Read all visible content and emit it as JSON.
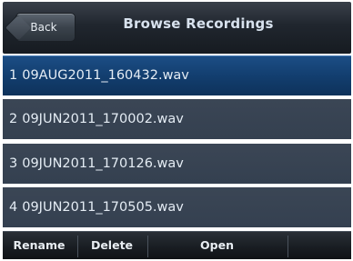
{
  "header": {
    "back_label": "Back",
    "title": "Browse Recordings"
  },
  "recordings": [
    {
      "index": "1",
      "filename": "09AUG2011_160432.wav",
      "selected": true
    },
    {
      "index": "2",
      "filename": "09JUN2011_170002.wav",
      "selected": false
    },
    {
      "index": "3",
      "filename": "09JUN2011_170126.wav",
      "selected": false
    },
    {
      "index": "4",
      "filename": "09JUN2011_170505.wav",
      "selected": false
    }
  ],
  "softkeys": {
    "rename": "Rename",
    "delete": "Delete",
    "open": "Open"
  },
  "colors": {
    "selected_row": "#1c4e86",
    "row": "#3b4655",
    "titlebar": "#20262e",
    "softkey_bar": "#181c21"
  }
}
